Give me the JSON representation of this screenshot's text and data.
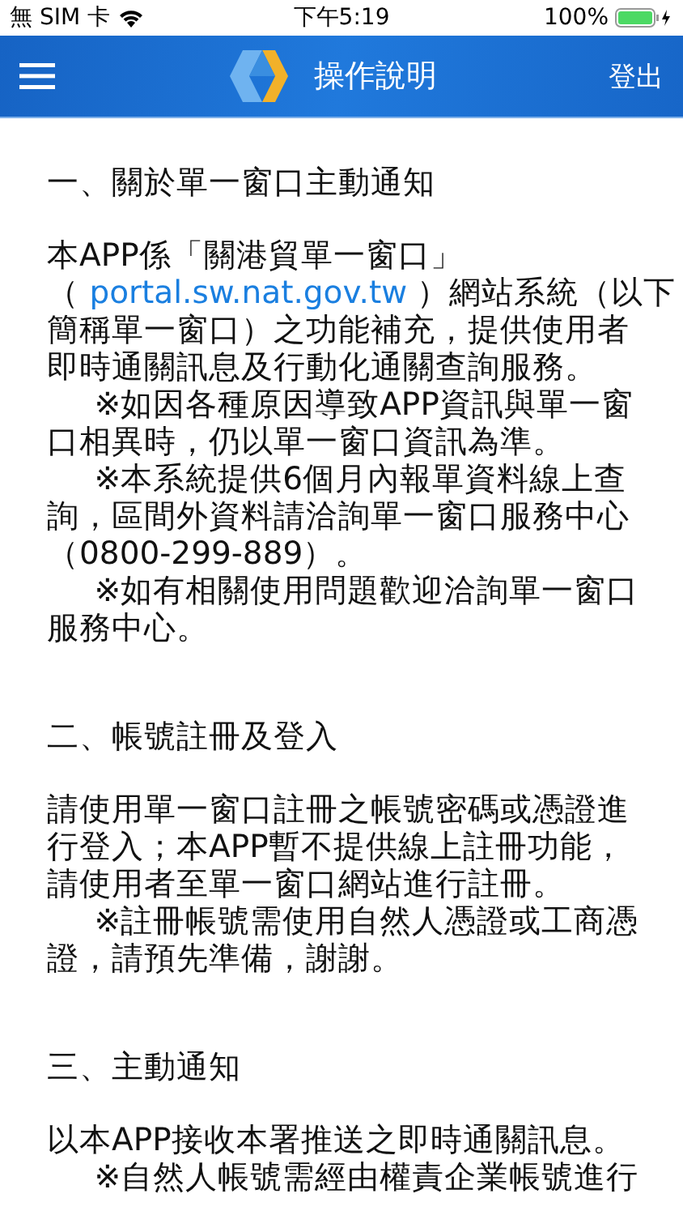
{
  "status_bar": {
    "carrier": "無 SIM 卡",
    "time": "下午5:19",
    "battery": "100%"
  },
  "header": {
    "title": "操作說明",
    "logout": "登出"
  },
  "sections": [
    {
      "heading": "一、關於單一窗口主動通知",
      "paragraphs": [
        {
          "lines": [
            {
              "indent": false,
              "parts": [
                {
                  "kind": "text",
                  "text": "本APP係「關港貿單一窗口」"
                }
              ]
            },
            {
              "indent": false,
              "parts": [
                {
                  "kind": "text",
                  "text": "（ "
                },
                {
                  "kind": "link",
                  "text": "portal.sw.nat.gov.tw"
                },
                {
                  "kind": "text",
                  "text": " ）網站系統（以下"
                }
              ]
            },
            {
              "indent": false,
              "parts": [
                {
                  "kind": "text",
                  "text": "簡稱單一窗口）之功能補充，提供使用者"
                }
              ]
            },
            {
              "indent": false,
              "parts": [
                {
                  "kind": "text",
                  "text": "即時通關訊息及行動化通關查詢服務。"
                }
              ]
            }
          ]
        },
        {
          "lines": [
            {
              "indent": true,
              "parts": [
                {
                  "kind": "text",
                  "text": "※如因各種原因導致APP資訊與單一窗"
                }
              ]
            },
            {
              "indent": false,
              "parts": [
                {
                  "kind": "text",
                  "text": "口相異時，仍以單一窗口資訊為準。"
                }
              ]
            }
          ]
        },
        {
          "lines": [
            {
              "indent": true,
              "parts": [
                {
                  "kind": "text",
                  "text": "※本系統提供6個月內報單資料線上查"
                }
              ]
            },
            {
              "indent": false,
              "parts": [
                {
                  "kind": "text",
                  "text": "詢，區間外資料請洽詢單一窗口服務中心"
                }
              ]
            },
            {
              "indent": false,
              "parts": [
                {
                  "kind": "text",
                  "text": "（0800-299-889）。"
                }
              ]
            }
          ]
        },
        {
          "lines": [
            {
              "indent": true,
              "parts": [
                {
                  "kind": "text",
                  "text": "※如有相關使用問題歡迎洽詢單一窗口"
                }
              ]
            },
            {
              "indent": false,
              "parts": [
                {
                  "kind": "text",
                  "text": "服務中心。"
                }
              ]
            }
          ]
        }
      ]
    },
    {
      "heading": "二、帳號註冊及登入",
      "paragraphs": [
        {
          "lines": [
            {
              "indent": false,
              "parts": [
                {
                  "kind": "text",
                  "text": "請使用單一窗口註冊之帳號密碼或憑證進"
                }
              ]
            },
            {
              "indent": false,
              "parts": [
                {
                  "kind": "text",
                  "text": "行登入；本APP暫不提供線上註冊功能，"
                }
              ]
            },
            {
              "indent": false,
              "parts": [
                {
                  "kind": "text",
                  "text": "請使用者至單一窗口網站進行註冊。"
                }
              ]
            }
          ]
        },
        {
          "lines": [
            {
              "indent": true,
              "parts": [
                {
                  "kind": "text",
                  "text": "※註冊帳號需使用自然人憑證或工商憑"
                }
              ]
            },
            {
              "indent": false,
              "parts": [
                {
                  "kind": "text",
                  "text": "證，請預先準備，謝謝。"
                }
              ]
            }
          ]
        }
      ]
    },
    {
      "heading": "三、主動通知",
      "paragraphs": [
        {
          "lines": [
            {
              "indent": false,
              "parts": [
                {
                  "kind": "text",
                  "text": "以本APP接收本署推送之即時通關訊息。"
                }
              ]
            }
          ]
        },
        {
          "lines": [
            {
              "indent": true,
              "parts": [
                {
                  "kind": "text",
                  "text": "※自然人帳號需經由權責企業帳號進行"
                }
              ]
            }
          ]
        }
      ]
    }
  ]
}
